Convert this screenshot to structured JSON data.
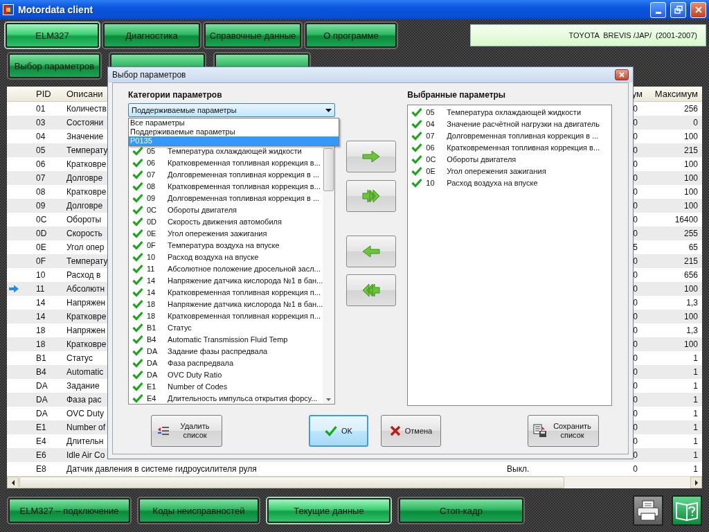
{
  "window": {
    "title": "Motordata client"
  },
  "main_menu": [
    {
      "label": "ELM327",
      "selected": true
    },
    {
      "label": "Диагностика",
      "selected": false
    },
    {
      "label": "Справочные данные",
      "selected": false
    },
    {
      "label": "О программе",
      "selected": false
    }
  ],
  "vehicle": "TOYOTA  BREVIS /JAP/  (2001-2007)",
  "toolbar": [
    {
      "label": "Выбор параметров"
    }
  ],
  "table": {
    "columns": [
      "PID",
      "Описани",
      "ум",
      "Максимум"
    ],
    "rows": [
      {
        "pid": "01",
        "description": "Количеств",
        "minimum": "0",
        "maximum": "256",
        "current": false
      },
      {
        "pid": "03",
        "description": "Состояни",
        "minimum": "0",
        "maximum": "0",
        "current": false
      },
      {
        "pid": "04",
        "description": "Значение",
        "minimum": "0",
        "maximum": "100",
        "current": false
      },
      {
        "pid": "05",
        "description": "Температу",
        "minimum": "0",
        "maximum": "215",
        "current": false
      },
      {
        "pid": "06",
        "description": "Кратковре",
        "minimum": "0",
        "maximum": "100",
        "current": false
      },
      {
        "pid": "07",
        "description": "Долговре",
        "minimum": "0",
        "maximum": "100",
        "current": false
      },
      {
        "pid": "08",
        "description": "Кратковре",
        "minimum": "0",
        "maximum": "100",
        "current": false
      },
      {
        "pid": "09",
        "description": "Долговре",
        "minimum": "0",
        "maximum": "100",
        "current": false
      },
      {
        "pid": "0C",
        "description": "Обороты",
        "minimum": "0",
        "maximum": "16400",
        "current": false
      },
      {
        "pid": "0D",
        "description": "Скорость",
        "minimum": "0",
        "maximum": "255",
        "current": false
      },
      {
        "pid": "0E",
        "description": "Угол опер",
        "minimum": "5",
        "maximum": "65",
        "current": false
      },
      {
        "pid": "0F",
        "description": "Температу",
        "minimum": "0",
        "maximum": "215",
        "current": false
      },
      {
        "pid": "10",
        "description": "Расход в",
        "minimum": "0",
        "maximum": "656",
        "current": false
      },
      {
        "pid": "11",
        "description": "Абсолютн",
        "minimum": "0",
        "maximum": "100",
        "current": true
      },
      {
        "pid": "14",
        "description": "Напряжен",
        "minimum": "0",
        "maximum": "1,3",
        "current": false
      },
      {
        "pid": "14",
        "description": "Кратковре",
        "minimum": "0",
        "maximum": "100",
        "current": false
      },
      {
        "pid": "18",
        "description": "Напряжен",
        "minimum": "0",
        "maximum": "1,3",
        "current": false
      },
      {
        "pid": "18",
        "description": "Кратковре",
        "minimum": "0",
        "maximum": "100",
        "current": false
      },
      {
        "pid": "B1",
        "description": "Статус",
        "minimum": "0",
        "maximum": "1",
        "current": false
      },
      {
        "pid": "B4",
        "description": "Automatic",
        "minimum": "0",
        "maximum": "1",
        "current": false
      },
      {
        "pid": "DA",
        "description": "Задание",
        "minimum": "0",
        "maximum": "1",
        "current": false
      },
      {
        "pid": "DA",
        "description": "Фаза рас",
        "minimum": "0",
        "maximum": "1",
        "current": false
      },
      {
        "pid": "DA",
        "description": "OVC Duty",
        "minimum": "0",
        "maximum": "1",
        "current": false
      },
      {
        "pid": "E1",
        "description": "Number of",
        "minimum": "0",
        "maximum": "1",
        "current": false
      },
      {
        "pid": "E4",
        "description": "Длительн",
        "minimum": "0",
        "maximum": "1",
        "current": false
      },
      {
        "pid": "E6",
        "description": "Idle Air Co",
        "minimum": "0",
        "maximum": "1",
        "current": false
      },
      {
        "pid": "E8",
        "description": "Датчик давления в системе гидроусилителя руля",
        "value": "Выкл.",
        "minimum": "0",
        "maximum": "1",
        "current": false
      }
    ]
  },
  "bottom_tabs": [
    {
      "label": "ELM327 – подключение",
      "selected": false
    },
    {
      "label": "Коды неисправностей",
      "selected": false
    },
    {
      "label": "Текущие данные",
      "selected": true
    },
    {
      "label": "Стоп-кадр",
      "selected": false
    }
  ],
  "dialog": {
    "title": "Выбор параметров",
    "categories_label": "Категории параметров",
    "category_value": "Поддерживаемые параметры",
    "category_options": [
      {
        "label": "Все параметры",
        "selected": false
      },
      {
        "label": "Поддерживаемые параметры",
        "selected": false
      },
      {
        "label": "P0135",
        "selected": true
      }
    ],
    "available": [
      {
        "pid": "05",
        "name": "Температура охлаждающей жидкости"
      },
      {
        "pid": "06",
        "name": "Кратковременная топливная коррекция в..."
      },
      {
        "pid": "07",
        "name": "Долговременная топливная коррекция в ..."
      },
      {
        "pid": "08",
        "name": "Кратковременная топливная коррекция в..."
      },
      {
        "pid": "09",
        "name": "Долговременная топливная коррекция в ..."
      },
      {
        "pid": "0C",
        "name": "Обороты двигателя"
      },
      {
        "pid": "0D",
        "name": "Скорость движения автомобиля"
      },
      {
        "pid": "0E",
        "name": "Угол опережения зажигания"
      },
      {
        "pid": "0F",
        "name": "Температура воздуха на впуске"
      },
      {
        "pid": "10",
        "name": "Расход воздуха на впуске"
      },
      {
        "pid": "11",
        "name": "Абсолютное положение дросельной засл..."
      },
      {
        "pid": "14",
        "name": "Напряжение датчика кислорода №1 в бан..."
      },
      {
        "pid": "14",
        "name": "Кратковременная топливная коррекция п..."
      },
      {
        "pid": "18",
        "name": "Напряжение датчика кислорода №1 в бан..."
      },
      {
        "pid": "18",
        "name": "Кратковременная топливная коррекция п..."
      },
      {
        "pid": "B1",
        "name": "Статус"
      },
      {
        "pid": "B4",
        "name": "Automatic Transmission Fluid Temp"
      },
      {
        "pid": "DA",
        "name": "Задание фазы распредвала"
      },
      {
        "pid": "DA",
        "name": "Фаза распредвала"
      },
      {
        "pid": "DA",
        "name": "OVC Duty Ratio"
      },
      {
        "pid": "E1",
        "name": "Number of Codes"
      },
      {
        "pid": "E4",
        "name": "Длительность импульса открытия форсу..."
      }
    ],
    "selected_label": "Выбранные параметры",
    "selected_params": [
      {
        "pid": "05",
        "name": "Температура охлаждающей жидкости"
      },
      {
        "pid": "04",
        "name": "Значение расчётной нагрузки на двигатель"
      },
      {
        "pid": "07",
        "name": "Долговременная топливная коррекция в ..."
      },
      {
        "pid": "06",
        "name": "Кратковременная топливная коррекция в..."
      },
      {
        "pid": "0C",
        "name": "Обороты двигателя"
      },
      {
        "pid": "0E",
        "name": "Угол опережения зажигания"
      },
      {
        "pid": "10",
        "name": "Расход воздуха на впуске"
      }
    ],
    "transfer_buttons": [
      {
        "kind": "add"
      },
      {
        "kind": "add_all"
      },
      {
        "kind": "remove"
      },
      {
        "kind": "remove_all"
      }
    ],
    "buttons": [
      {
        "kind": "delete",
        "label": "Удалить список",
        "focused": false
      },
      {
        "kind": "ok",
        "label": "OK",
        "focused": true
      },
      {
        "kind": "cancel",
        "label": "Отмена",
        "focused": false
      },
      {
        "kind": "save",
        "label": "Сохранить список",
        "focused": false
      }
    ]
  }
}
